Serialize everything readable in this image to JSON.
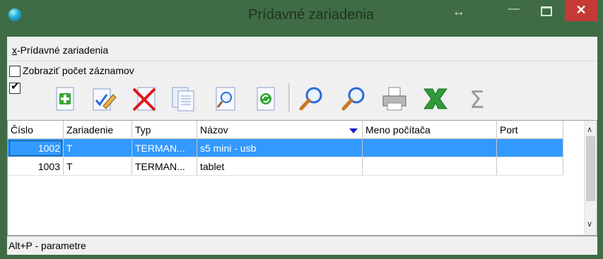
{
  "window": {
    "title": "Prídavné zariadenia"
  },
  "menu": {
    "item_accel": "x",
    "item_rest": "-Prídavné zariadenia"
  },
  "options": {
    "show_count_label": "Zobraziť počet záznamov",
    "show_count_checked": false,
    "filter_checked": true
  },
  "toolbar": {
    "buttons": [
      "add-icon",
      "edit-icon",
      "delete-icon",
      "copy-icon",
      "view-icon",
      "refresh-icon",
      "search-icon",
      "search-next-icon",
      "print-icon",
      "excel-icon",
      "sum-icon"
    ]
  },
  "table": {
    "columns": [
      "Číslo",
      "Zariadenie",
      "Typ",
      "Názov",
      "Meno počítača",
      "Port"
    ],
    "rows": [
      {
        "cislo": "1002",
        "zariadenie": "T",
        "typ": "TERMAN...",
        "nazov": "s5 mini - usb",
        "meno": "",
        "port": "",
        "selected": true
      },
      {
        "cislo": "1003",
        "zariadenie": "T",
        "typ": "TERMAN...",
        "nazov": "tablet",
        "meno": "",
        "port": "",
        "selected": false
      }
    ]
  },
  "status": {
    "text": "Alt+P - parametre"
  },
  "colors": {
    "title_bg": "#3f6c45",
    "close_btn": "#c43b35",
    "selection": "#3399ff"
  }
}
